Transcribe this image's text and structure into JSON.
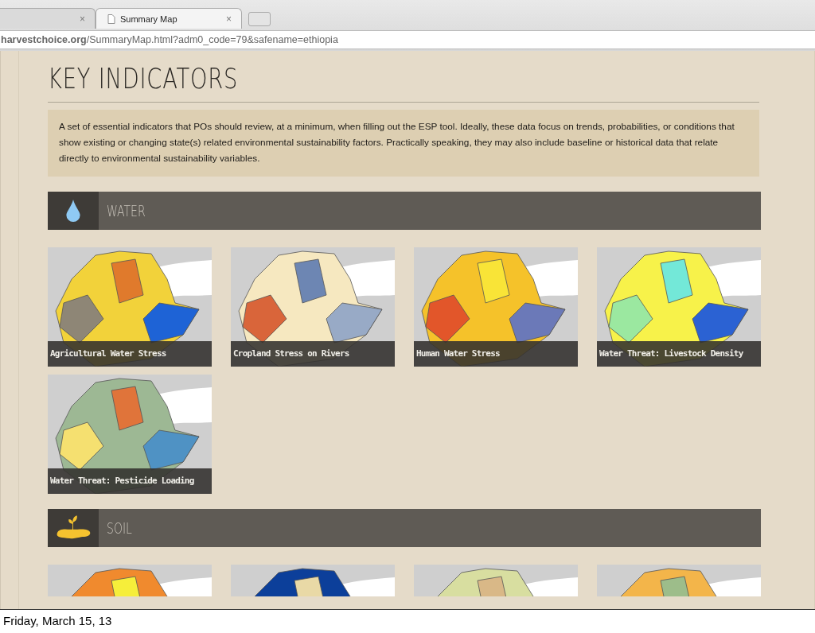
{
  "browser": {
    "tabs": [
      {
        "close": "×",
        "selected": false
      },
      {
        "label": "Summary Map",
        "close": "×",
        "selected": true
      }
    ],
    "address": "**harvestchoice.org**/SummaryMap.html?adm0_code=79&safename=ethiopia"
  },
  "page": {
    "heading": "KEY INDICATORS",
    "description": "A set of essential indicators that POs should review, at a minimum, when filling out the ESP tool. Ideally, these data focus on trends, probabilities, or conditions that show existing or changing state(s) related environmental sustainability factors. Practically speaking, they may also include baseline or historical data that relate directly to environmental sustainability variables.",
    "sections": [
      {
        "title": "WATER",
        "kind": "drop",
        "maps": [
          {
            "kind": "map",
            "caption": "Agricultural Water Stress"
          },
          {
            "kind": "map",
            "caption": "Cropland Stress on Rivers"
          },
          {
            "kind": "map",
            "caption": "Human Water Stress"
          },
          {
            "kind": "map",
            "caption": "Water Threat: Livestock Density"
          },
          {
            "kind": "map",
            "caption": "Water Threat: Pesticide Loading"
          }
        ]
      },
      {
        "title": "SOIL",
        "kind": "sprout",
        "maps": [
          {
            "kind": "map"
          },
          {
            "kind": "map"
          },
          {
            "kind": "map"
          },
          {
            "kind": "map"
          }
        ]
      }
    ]
  },
  "footer": {
    "date": "Friday, March 15, 13"
  }
}
